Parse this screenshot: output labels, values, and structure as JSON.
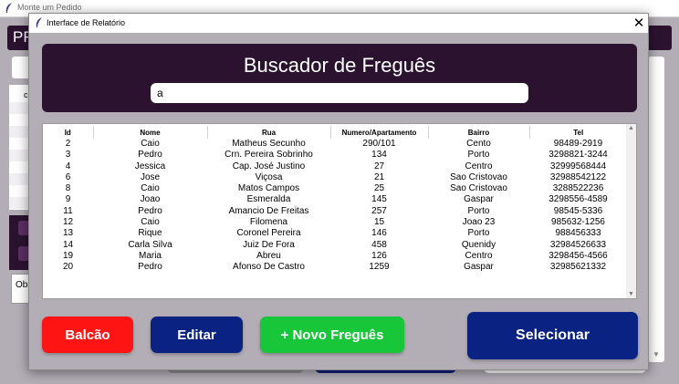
{
  "background_window": {
    "title": "Monte um Pedido",
    "heading_fragment": "PR",
    "table_header_fragment": "c",
    "obs_fragment": "Obs"
  },
  "dialog": {
    "title": "Interface de Relatório",
    "close_glyph": "✕",
    "header_title": "Buscador de Freguês",
    "search_value": "a"
  },
  "table": {
    "columns": [
      "Id",
      "Nome",
      "Rua",
      "Numero/Apartamento",
      "Bairro",
      "Tel"
    ],
    "rows": [
      [
        "2",
        "Caio",
        "Matheus Secunho",
        "290/101",
        "Cento",
        "98489-2919"
      ],
      [
        "3",
        "Pedro",
        "Crn. Pereira Sobrinho",
        "134",
        "Porto",
        "3298821-3244"
      ],
      [
        "4",
        "Jessica",
        "Cap. José Justino",
        "27",
        "Centro",
        "32999568444"
      ],
      [
        "6",
        "Jose",
        "Viçosa",
        "21",
        "Sao Cristovao",
        "32988542122"
      ],
      [
        "8",
        "Caio",
        "Matos Campos",
        "25",
        "Sao Cristovao",
        "3288522236"
      ],
      [
        "9",
        "Joao",
        "Esmeralda",
        "145",
        "Gaspar",
        "3298556-4589"
      ],
      [
        "11",
        "Pedro",
        "Amancio De Freitas",
        "257",
        "Porto",
        "98545-5336"
      ],
      [
        "12",
        "Caio",
        "Filomena",
        "15",
        "Joao 23",
        "985632-1256"
      ],
      [
        "13",
        "Rique",
        "Coronel Pereira",
        "146",
        "Porto",
        "988456333"
      ],
      [
        "14",
        "Carla Silva",
        "Juiz De Fora",
        "458",
        "Quenidy",
        "32984526633"
      ],
      [
        "19",
        "Maria",
        "Abreu",
        "126",
        "Centro",
        "3298456-4566"
      ],
      [
        "20",
        "Pedro",
        "Afonso De Castro",
        "1259",
        "Gaspar",
        "32985621332"
      ]
    ]
  },
  "buttons": {
    "balcao": "Balcão",
    "editar": "Editar",
    "novo": "+ Novo Freguês",
    "selecionar": "Selecionar"
  },
  "colors": {
    "header_bg": "#2b1330",
    "window_bg": "#b3adb6",
    "balcao": "#ff1414",
    "editar": "#0a2383",
    "novo": "#18c63a",
    "selecionar": "#0a2383"
  }
}
